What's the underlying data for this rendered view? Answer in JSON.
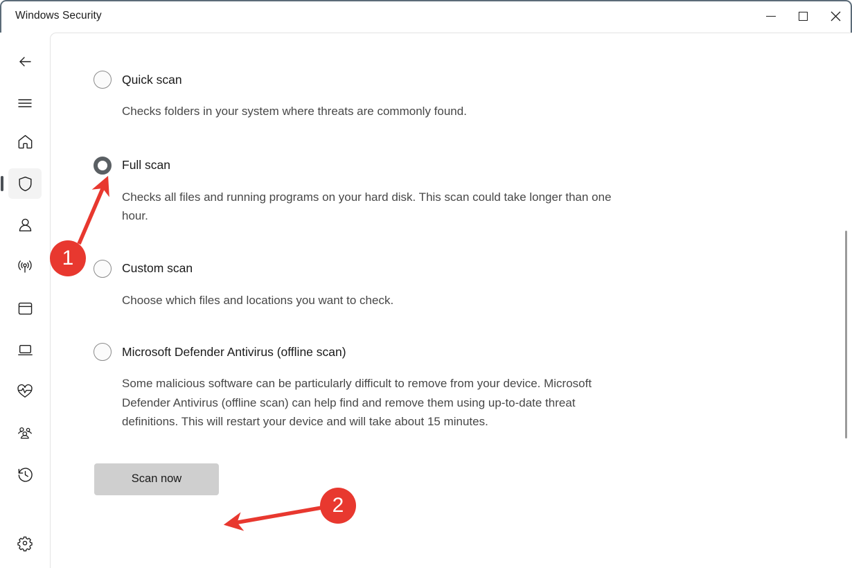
{
  "window": {
    "title": "Windows Security",
    "controls": {
      "minimize": "Minimize",
      "maximize": "Maximize",
      "close": "Close"
    }
  },
  "sidebar": {
    "items": [
      {
        "icon": "back-arrow-icon",
        "name": "back",
        "label": "Back",
        "selected": false
      },
      {
        "icon": "hamburger-menu-icon",
        "name": "menu",
        "label": "Menu",
        "selected": false
      },
      {
        "icon": "home-icon",
        "name": "home",
        "label": "Home",
        "selected": false
      },
      {
        "icon": "shield-icon",
        "name": "virus-threat-protection",
        "label": "Virus & threat protection",
        "selected": true
      },
      {
        "icon": "person-icon",
        "name": "account-protection",
        "label": "Account protection",
        "selected": false
      },
      {
        "icon": "wifi-signal-icon",
        "name": "firewall-network-protection",
        "label": "Firewall & network protection",
        "selected": false
      },
      {
        "icon": "app-window-icon",
        "name": "app-browser-control",
        "label": "App & browser control",
        "selected": false
      },
      {
        "icon": "laptop-icon",
        "name": "device-security",
        "label": "Device security",
        "selected": false
      },
      {
        "icon": "heart-pulse-icon",
        "name": "device-performance-health",
        "label": "Device performance & health",
        "selected": false
      },
      {
        "icon": "family-group-icon",
        "name": "family-options",
        "label": "Family options",
        "selected": false
      },
      {
        "icon": "history-clock-icon",
        "name": "protection-history",
        "label": "Protection history",
        "selected": false
      },
      {
        "icon": "gear-icon",
        "name": "settings",
        "label": "Settings",
        "selected": false
      }
    ]
  },
  "main": {
    "scan_options": [
      {
        "label": "Quick scan",
        "description": "Checks folders in your system where threats are commonly found.",
        "selected": false
      },
      {
        "label": "Full scan",
        "description": "Checks all files and running programs on your hard disk. This scan could take longer than one hour.",
        "selected": true
      },
      {
        "label": "Custom scan",
        "description": "Choose which files and locations you want to check.",
        "selected": false
      },
      {
        "label": "Microsoft Defender Antivirus (offline scan)",
        "description": "Some malicious software can be particularly difficult to remove from your device. Microsoft Defender Antivirus (offline scan) can help find and remove them using up-to-date threat definitions. This will restart your device and will take about 15 minutes.",
        "selected": false
      }
    ],
    "scan_now_button": "Scan now"
  },
  "annotations": {
    "color": "#e8382f",
    "markers": [
      {
        "id": "1",
        "label": "1",
        "target": "full-scan-radio"
      },
      {
        "id": "2",
        "label": "2",
        "target": "scan-now-button"
      }
    ]
  }
}
